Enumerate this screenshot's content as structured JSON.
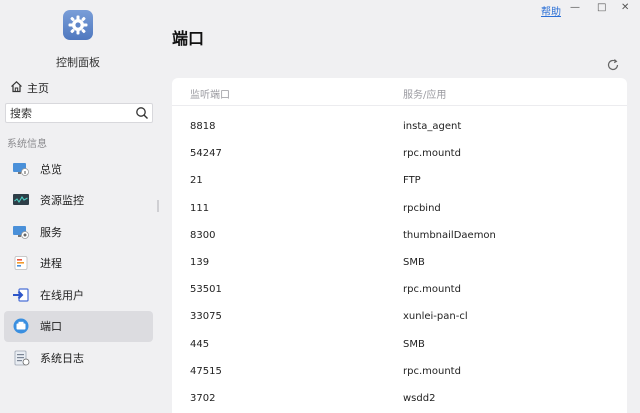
{
  "window": {
    "help_label": "帮助",
    "minimize_glyph": "—",
    "maximize_glyph": "□",
    "close_glyph": "✕"
  },
  "app": {
    "title": "控制面板",
    "icon": "gear-icon"
  },
  "sidebar": {
    "home_label": "主页",
    "search_placeholder": "搜索",
    "section_label": "系统信息",
    "items": [
      {
        "label": "总览",
        "icon": "monitor-info-icon"
      },
      {
        "label": "资源监控",
        "icon": "resource-monitor-icon"
      },
      {
        "label": "服务",
        "icon": "service-icon"
      },
      {
        "label": "进程",
        "icon": "process-list-icon"
      },
      {
        "label": "在线用户",
        "icon": "online-user-icon"
      },
      {
        "label": "端口",
        "icon": "port-icon"
      },
      {
        "label": "系统日志",
        "icon": "system-log-icon"
      }
    ],
    "active_index": 5
  },
  "main": {
    "title": "端口",
    "columns": [
      "监听端口",
      "服务/应用"
    ],
    "rows": [
      {
        "port": "8818",
        "service": "insta_agent"
      },
      {
        "port": "54247",
        "service": "rpc.mountd"
      },
      {
        "port": "21",
        "service": "FTP"
      },
      {
        "port": "111",
        "service": "rpcbind"
      },
      {
        "port": "8300",
        "service": "thumbnailDaemon"
      },
      {
        "port": "139",
        "service": "SMB"
      },
      {
        "port": "53501",
        "service": "rpc.mountd"
      },
      {
        "port": "33075",
        "service": "xunlei-pan-cl"
      },
      {
        "port": "445",
        "service": "SMB"
      },
      {
        "port": "47515",
        "service": "rpc.mountd"
      },
      {
        "port": "3702",
        "service": "wsdd2"
      }
    ]
  },
  "colors": {
    "accent": "#2a6fd6",
    "active_bg": "#dcdce0"
  }
}
